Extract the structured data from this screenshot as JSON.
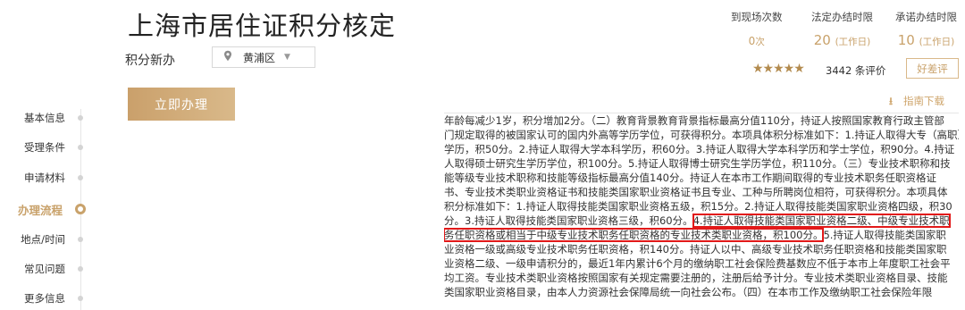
{
  "header": {
    "title": "上海市居住证积分核定",
    "subtitle": "积分新办",
    "district": "黄浦区"
  },
  "stats": [
    {
      "label": "到现场次数",
      "value": "0",
      "unit": "次"
    },
    {
      "label": "法定办结时限",
      "value": "20",
      "unit": "(工作日)"
    },
    {
      "label": "承诺办结时限",
      "value": "10",
      "unit": "(工作日)"
    }
  ],
  "rating": {
    "stars": "★★★★★",
    "stars_value": 5,
    "count_text": "3442 条评价",
    "review_button": "好差评"
  },
  "actions": {
    "apply": "立即办理",
    "download_guide": "指南下载"
  },
  "sidebar": {
    "items": [
      {
        "label": "基本信息",
        "active": false
      },
      {
        "label": "受理条件",
        "active": false
      },
      {
        "label": "申请材料",
        "active": false
      },
      {
        "label": "办理流程",
        "active": true
      },
      {
        "label": "地点/时间",
        "active": false
      },
      {
        "label": "常见问题",
        "active": false
      },
      {
        "label": "更多信息",
        "active": false
      }
    ]
  },
  "content": {
    "lines": [
      "年龄每减少1岁，积分增加2分。（二）教育背景教育背景指标最高分值110分，持证人按照国家教育行政主管部",
      "门规定取得的被国家认可的国内外高等学历学位，可获得积分。本项具体积分标准如下：1.持证人取得大专（高职）",
      "学历，积50分。2.持证人取得大学本科学历，积60分。3.持证人取得大学本科学历和学士学位，积90分。4.持证",
      "人取得硕士研究生学历学位，积100分。5.持证人取得博士研究生学历学位，积110分。（三）专业技术职称和技",
      "能等级专业技术职称和技能等级指标最高分值140分。持证人在本市工作期间取得的专业技术职务任职资格证",
      "书、专业技术类职业资格证书和技能类国家职业资格证书且专业、工种与所聘岗位相符，可获得积分。本项具体",
      "积分标准如下：1.持证人取得技能类国家职业资格五级，积15分。2.持证人取得技能类国家职业资格四级，积30",
      "分。3.持证人取得技能类国家职业资格三级，积60分。",
      "4.持证人取得技能类国家职业资格二级、中级专业技术职",
      "务任职资格或相当于中级专业技术职务任职资格的专业技术类职业资格，积100分。",
      "5.持证人取得技能类国家职",
      "业资格一级或高级专业技术职务任职资格，积140分。持证人以中、高级专业技术职务任职资格和技能类国家职",
      "业资格二级、一级申请积分的，最近1年内累计6个月的缴纳职工社会保险费基数应不低于本市上年度职工社会平",
      "均工资。专业技术类职业资格按照国家有关规定需要注册的，注册后给予计分。专业技术类职业资格目录、技能",
      "类国家职业资格目录，由本人力资源社会保障局统一向社会公布。（四）在本市工作及缴纳职工社会保险年限"
    ]
  }
}
